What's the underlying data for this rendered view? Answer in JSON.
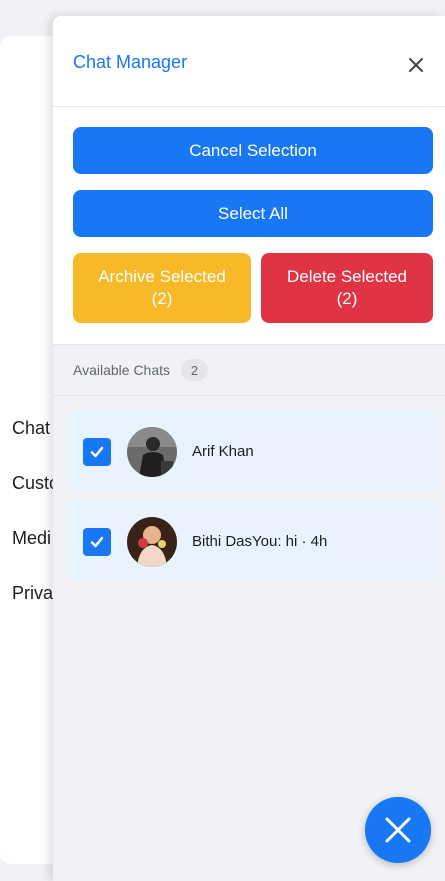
{
  "background": {
    "items": [
      "Chat",
      "Custo",
      "Medi",
      "Priva"
    ]
  },
  "panel": {
    "title": "Chat Manager",
    "close_icon": "close-icon"
  },
  "actions": {
    "cancel_label": "Cancel Selection",
    "select_all_label": "Select All",
    "archive_label": "Archive Selected",
    "archive_count": "(2)",
    "delete_label": "Delete Selected",
    "delete_count": "(2)"
  },
  "chats_section": {
    "title": "Available Chats",
    "count": "2",
    "chats": [
      {
        "name": "Arif Khan",
        "selected": true
      },
      {
        "name": "Bithi DasYou: hi  · 4h",
        "selected": true
      }
    ]
  },
  "fab": {
    "icon": "close-icon"
  },
  "colors": {
    "primary": "#1877f2",
    "archive": "#f7b928",
    "delete": "#e03444",
    "row_selected": "#e7f3ff"
  }
}
